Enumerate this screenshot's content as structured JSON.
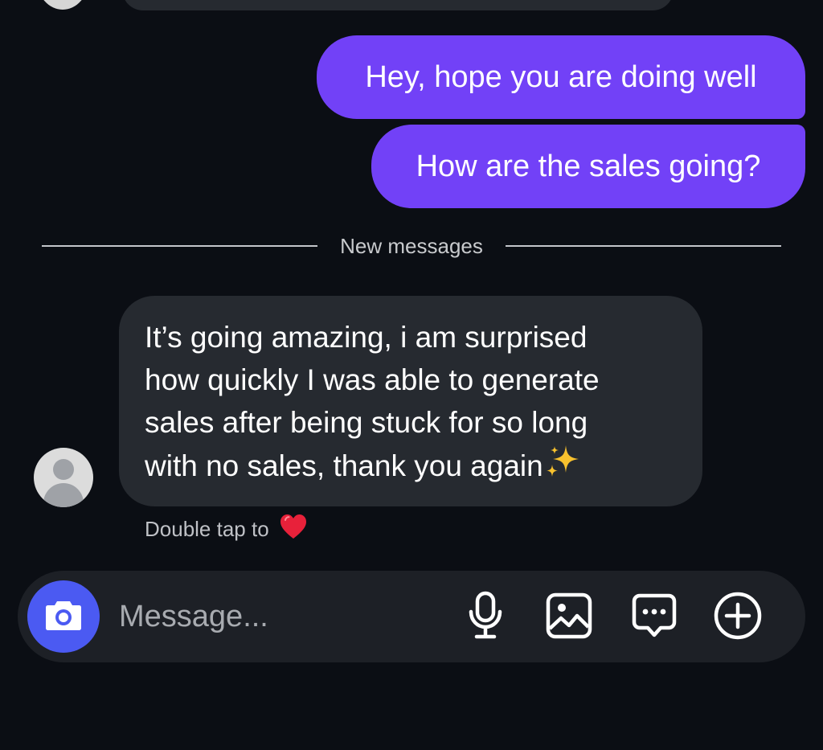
{
  "thread": {
    "outgoing_messages": [
      {
        "text": "Hey, hope you are doing well"
      },
      {
        "text": "How are the sales going?"
      }
    ],
    "new_messages_label": "New messages",
    "incoming_message": {
      "lines": [
        "It’s going amazing, i am surprised",
        "how quickly I was able to generate",
        "sales after being stuck for so long",
        "with no sales, thank you again"
      ],
      "emoji": "sparkles-emoji"
    },
    "double_tap_label": "Double tap to",
    "double_tap_icon": "heart-icon"
  },
  "composer": {
    "placeholder": "Message...",
    "icons": [
      "camera-icon",
      "microphone-icon",
      "gallery-icon",
      "sticker-chat-icon",
      "plus-circle-icon"
    ]
  },
  "colors": {
    "background": "#0b0e14",
    "outgoing_bubble": "#7241f7",
    "incoming_bubble": "#262a30",
    "camera_button": "#4b5af2",
    "heart": "#e8213a",
    "sparkle": "#f7c12e"
  }
}
